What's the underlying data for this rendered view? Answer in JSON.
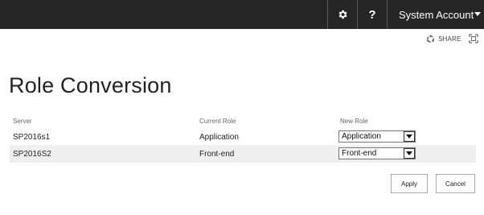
{
  "suitebar": {
    "settings_icon": "gear-icon",
    "help_label": "?",
    "account_name": "System Account"
  },
  "ribbon": {
    "share_label": "SHARE",
    "share_icon": "share-icon",
    "focus_icon": "focus-on-content-icon"
  },
  "page": {
    "title": "Role Conversion"
  },
  "table": {
    "headers": [
      "Server",
      "Current Role",
      "New Role"
    ],
    "rows": [
      {
        "server": "SP2016s1",
        "current_role": "Application",
        "new_role": "Application"
      },
      {
        "server": "SP2016S2",
        "current_role": "Front-end",
        "new_role": "Front-end"
      }
    ]
  },
  "actions": {
    "apply_label": "Apply",
    "cancel_label": "Cancel"
  }
}
